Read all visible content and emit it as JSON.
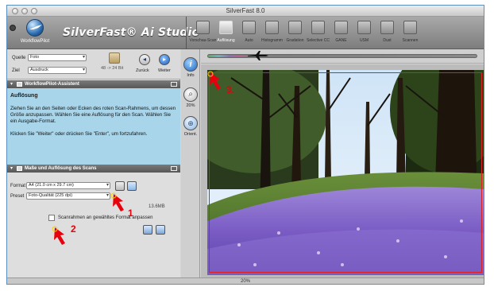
{
  "window": {
    "title": "SilverFast 8.0"
  },
  "header": {
    "workflow_label": "WorkflowPilot",
    "brand": "SilverFast® Ai Studio",
    "tools": [
      {
        "label": "Vorschau-Scan",
        "active": false,
        "icon": "prescan-icon"
      },
      {
        "label": "Auflösung",
        "active": true,
        "icon": "resolution-icon"
      },
      {
        "label": "Auto",
        "active": false,
        "icon": "auto-icon"
      },
      {
        "label": "Histogramm",
        "active": false,
        "icon": "histogram-icon"
      },
      {
        "label": "Gradation",
        "active": false,
        "icon": "gradation-icon"
      },
      {
        "label": "Selective CC",
        "active": false,
        "icon": "selective-color-icon"
      },
      {
        "label": "GANE",
        "active": false,
        "icon": "gane-icon"
      },
      {
        "label": "USM",
        "active": false,
        "icon": "usm-icon"
      },
      {
        "label": "Dust",
        "active": false,
        "icon": "dust-icon"
      },
      {
        "label": "Scannen",
        "active": false,
        "icon": "scan-icon"
      }
    ]
  },
  "source_panel": {
    "quelle_label": "Quelle",
    "quelle_value": "Foto",
    "ziel_label": "Ziel",
    "ziel_value": "Ausdruck",
    "bit_depth": "48 -> 24 Bit",
    "back_label": "Zurück",
    "next_label": "Weiter"
  },
  "assistant": {
    "header": "WorkflowPilot-Assistent",
    "title": "Auflösung",
    "paragraph1": "Ziehen Sie an den Seiten oder Ecken des roten Scan-Rahmens, um dessen Größe anzupassen. Wählen Sie eine Auflösung für den Scan. Wählen Sie ein Ausgabe-Format.",
    "paragraph2": "Klicken Sie \"Weiter\" oder drücken Sie \"Enter\", um fortzufahren."
  },
  "scan_settings": {
    "header": "Maße und Auflösung des Scans",
    "format_label": "Format",
    "format_value": "A4 (21.0 cm x 29.7 cm)",
    "preset_label": "Preset",
    "preset_value": "Foto-Qualität (225 dpi)",
    "file_size": "13.6MB",
    "checkbox_label": "Scanrahmen an gewähltes Format anpassen"
  },
  "annotations": {
    "one": "1",
    "two": "2",
    "three": "3."
  },
  "side_tools": {
    "info_label": "Info",
    "zoom_value": "20%",
    "orient_label": "Orient."
  },
  "status_bar": {
    "zoom": "20%"
  },
  "colors": {
    "accent_blue": "#a9d5ea",
    "annotation_red": "#e8000c",
    "frame_border": "#5b8fc2"
  }
}
